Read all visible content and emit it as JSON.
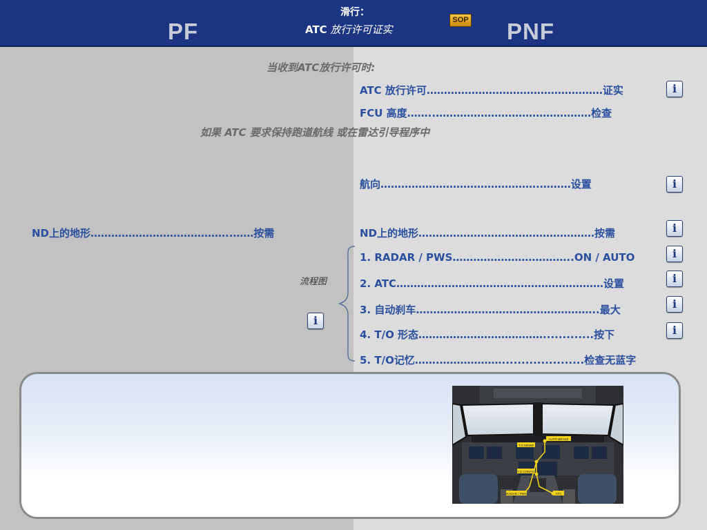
{
  "header": {
    "pf": "PF",
    "pnf": "PNF",
    "phase": "滑行：",
    "subtitle_atc": "ATC",
    "subtitle_rest": " 放行许可证实",
    "sop": "SOP"
  },
  "notes": {
    "on_receive": "当收到ATC放行许可时:",
    "runway_heading": "如果 ATC 要求保持跑道航线 或在雷达引导程序中"
  },
  "pnf_items": [
    {
      "label": "ATC 放行许可",
      "dots": "……………………………………………",
      "action": "证实"
    },
    {
      "label": "FCU 高度",
      "dots": "……..………………………………………",
      "action": "检查"
    },
    {
      "label": "航向",
      "dots": "……………………………………….………",
      "action": "设置"
    },
    {
      "label": "ND上的地形",
      "dots": "……………………………………………",
      "action": "按需"
    },
    {
      "label": "1. RADAR / PWS",
      "dots": "……………………………..",
      "action": "ON / AUTO"
    },
    {
      "label": "2. ATC",
      "dots": "……………………………………………………",
      "action": "设置"
    },
    {
      "label": "3. 自动刹车",
      "dots": "……………………………………………..",
      "action": "最大"
    },
    {
      "label": "4. T/O 形态",
      "dots": "……………………………….............",
      "action": "按下"
    },
    {
      "label": "5. T/O记忆",
      "dots": "…….……………….....................",
      "action": "检查无蓝字"
    }
  ],
  "pf_item": {
    "label": "ND上的地形",
    "dots": "…………………………………..……",
    "action": "按需"
  },
  "flow": {
    "label": "流程图"
  },
  "info_glyph": "i",
  "cockpit_labels": [
    "AUTO BRAKE",
    "T.O MEMO",
    "T.O CONFIG",
    "RADAR / PWS",
    "ATC"
  ],
  "colors": {
    "header_bg": "#1c3583",
    "item_text": "#2b4f9e",
    "note_text": "#6a6a6a",
    "pf_panel": "#c2c2c2",
    "pnf_panel": "#dcdcdc",
    "highlight": "#f2d21c"
  }
}
